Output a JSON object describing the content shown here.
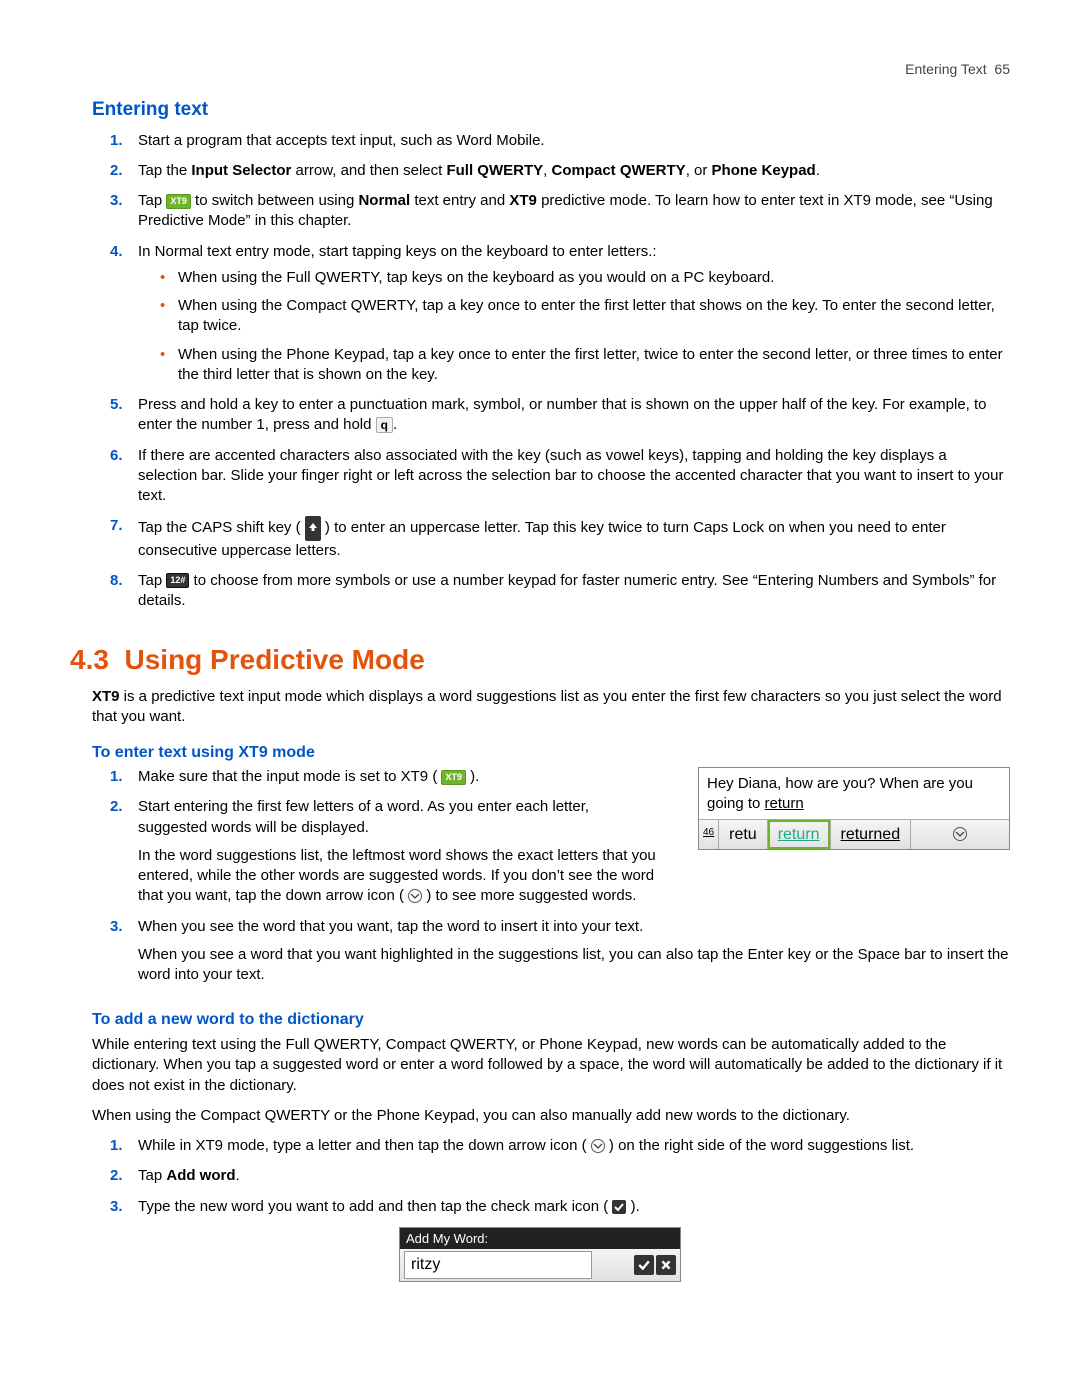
{
  "header": {
    "section": "Entering Text",
    "page": "65"
  },
  "sec1": {
    "title": "Entering text",
    "steps": {
      "s1": "Start a program that accepts text input, such as Word Mobile.",
      "s2a": "Tap the ",
      "s2b": "Input Selector",
      "s2c": " arrow, and then select ",
      "s2d": "Full QWERTY",
      "s2e": ", ",
      "s2f": "Compact QWERTY",
      "s2g": ", or ",
      "s2h": "Phone Keypad",
      "s2i": ".",
      "s3a": "Tap ",
      "s3b": " to switch between using ",
      "s3c": "Normal",
      "s3d": " text entry and ",
      "s3e": "XT9",
      "s3f": " predictive mode. To learn how to enter text in XT9 mode, see “Using Predictive Mode” in this chapter.",
      "s4": "In Normal text entry mode, start tapping keys on the keyboard to enter letters.:",
      "s4b1": "When using the Full QWERTY, tap keys on the keyboard as you would on a PC keyboard.",
      "s4b2": "When using the Compact QWERTY, tap a key once to enter the first letter that shows on the key. To enter the second letter, tap twice.",
      "s4b3": "When using the Phone Keypad, tap a key once to enter the first letter, twice to enter the second letter, or three times to enter the third letter that is shown on the key.",
      "s5a": "Press and hold a key to enter a punctuation mark, symbol, or number that is shown on the upper half of the key. For example, to enter the number 1, press and hold ",
      "s5b": ".",
      "s6": "If there are accented characters also associated with the key (such as vowel keys), tapping and holding the key displays a selection bar. Slide your finger right or left across the selection bar to choose the accented character that you want to insert to your text.",
      "s7a": "Tap the CAPS shift key ( ",
      "s7b": " ) to enter an uppercase letter. Tap this key twice to turn Caps Lock on when you need to enter consecutive uppercase letters.",
      "s8a": "Tap ",
      "s8b": " to choose from more symbols or use a number keypad for faster numeric entry. See “Entering Numbers and Symbols” for details."
    },
    "icons": {
      "xt9": "XT9",
      "qkey": "q",
      "num": "12#"
    }
  },
  "h1": {
    "num": "4.3",
    "title": "Using Predictive Mode"
  },
  "intro": {
    "a": "XT9",
    "b": " is a predictive text input mode which displays a word suggestions list as you enter the first few characters so you just select the word that you want."
  },
  "sec2": {
    "title": "To enter text using XT9 mode",
    "s1a": "Make sure that the input mode is set to XT9 ( ",
    "s1b": " ).",
    "s2": "Start entering the first few letters of a word. As you enter each letter, suggested words will be displayed.",
    "s2p": "In the word suggestions list, the leftmost word shows the exact letters that you entered, while the other words are suggested words. If you don’t see the word that you want, tap the down arrow icon ( ",
    "s2p2": " ) to see more suggested words.",
    "s3": "When you see the word that you want, tap the word to insert it into your text.",
    "s3p": "When you see a word that you want highlighted in the suggestions list, you can also tap the Enter key or the Space bar to insert the word into your text."
  },
  "sugg": {
    "text1": "Hey Diana, how are you? When are you going to ",
    "text2": "return",
    "count": "46",
    "w1": "retu",
    "w2": "return",
    "w3": "returned"
  },
  "sec3": {
    "title": "To add a new word to the dictionary",
    "p1": "While entering text using the Full QWERTY, Compact QWERTY, or Phone Keypad, new words can be automatically added to the dictionary. When you tap a suggested word or enter a word followed by a space, the word will automatically be added to the dictionary if it does not exist in the dictionary.",
    "p2": "When using the Compact QWERTY or the Phone Keypad, you can also manually add new words to the dictionary.",
    "s1a": "While in XT9 mode, type a letter and then tap the down arrow icon ( ",
    "s1b": " ) on the right side of the word suggestions list.",
    "s2a": "Tap ",
    "s2b": "Add word",
    "s2c": ".",
    "s3a": "Type the new word you want to add and then tap the check mark icon ( ",
    "s3b": " )."
  },
  "addfig": {
    "title": "Add My Word:",
    "value": "ritzy"
  }
}
